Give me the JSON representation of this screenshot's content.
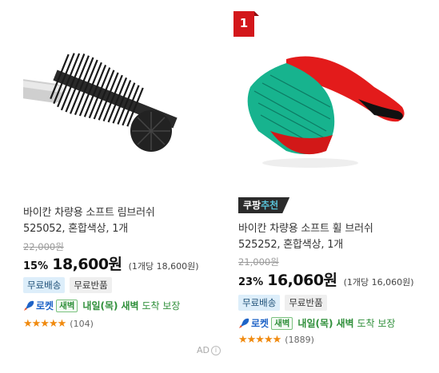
{
  "products": [
    {
      "name_line1": "바이칸 차량용 소프트 림브러쉬",
      "name_line2": "525052, 혼합색상, 1개",
      "original_price": "22,000원",
      "discount": "15%",
      "sale_price": "18,600원",
      "unit_price": "(1개당 18,600원)",
      "tags": [
        "무료배송",
        "무료반품"
      ],
      "delivery": {
        "label": "로켓",
        "badge": "새벽",
        "eta_day": "내일(목)",
        "eta_bold": "새벽",
        "eta_rest": "도착 보장"
      },
      "stars": "★★★★★",
      "reviews": "(104)"
    },
    {
      "rank": "1",
      "badge_part1": "쿠팡",
      "badge_part2": "추천",
      "name_line1": "바이칸 차량용 소프트 휠 브러쉬",
      "name_line2": "525252, 혼합색상, 1개",
      "original_price": "21,000원",
      "discount": "23%",
      "sale_price": "16,060원",
      "unit_price": "(1개당 16,060원)",
      "tags": [
        "무료배송",
        "무료반품"
      ],
      "delivery": {
        "label": "로켓",
        "badge": "새벽",
        "eta_day": "내일(목)",
        "eta_bold": "새벽",
        "eta_rest": "도착 보장"
      },
      "stars": "★★★★★",
      "reviews": "(1889)"
    }
  ],
  "ad_label": "AD",
  "ad_info_glyph": "i",
  "colors": {
    "accent_red": "#d3171b",
    "rocket_blue": "#1e63c7",
    "dawn_green": "#2f8f3a",
    "star_orange": "#f08a0f"
  }
}
